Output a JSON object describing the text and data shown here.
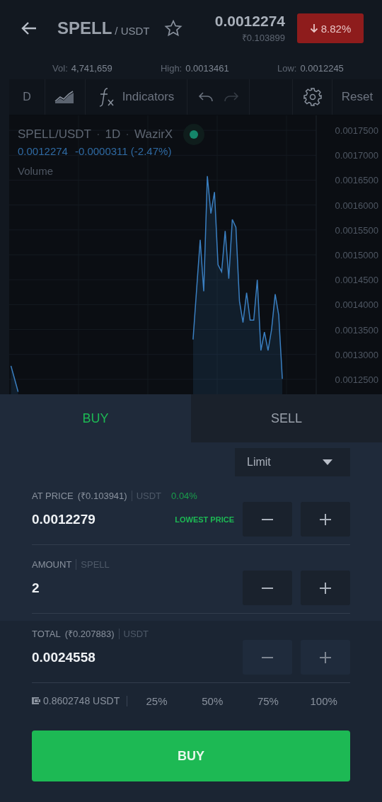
{
  "header": {
    "base": "SPELL",
    "quote": "/ USDT",
    "favorite": false,
    "price": "0.0012274",
    "price_inr": "₹0.103899",
    "change": "8.82%",
    "negative": true
  },
  "stats": [
    {
      "label": "Vol:",
      "value": "4,741,659"
    },
    {
      "label": "High:",
      "value": "0.0013461"
    },
    {
      "label": "Low:",
      "value": "0.0012245"
    }
  ],
  "toolbar": {
    "interval": "D",
    "indicators": "Indicators",
    "reset": "Reset"
  },
  "chart": {
    "separator": "·",
    "interval": "1D",
    "exchange": "WazirX",
    "last": "0.0012274",
    "change": "-0.0000311 (-2.47%)",
    "study": "Volume",
    "chart_data": {
      "type": "area",
      "categories": [
        null,
        null,
        null,
        null,
        null,
        null,
        null,
        null,
        null,
        null,
        null,
        null,
        null,
        null,
        null,
        null,
        null,
        null,
        null,
        null,
        null,
        null,
        null,
        null,
        null,
        null,
        null,
        null,
        null,
        null,
        null,
        null,
        null,
        null,
        null,
        null,
        null,
        null,
        null,
        null,
        null,
        null,
        null,
        null,
        null,
        null,
        null,
        null,
        null,
        null,
        null,
        null,
        null,
        null,
        null,
        null,
        null,
        null,
        null,
        null,
        null,
        null,
        null,
        null,
        null,
        null,
        null,
        null,
        null,
        null,
        null,
        null,
        null,
        null,
        null,
        null,
        null,
        null,
        null,
        null,
        null,
        null,
        null,
        null,
        null,
        null
      ],
      "series": [
        {
          "name": "SPELL/USDT",
          "color": "#3a7fc1",
          "values": [
            0.001277,
            0.001251,
            0.001225,
            null,
            null,
            null,
            null,
            null,
            null,
            null,
            null,
            null,
            null,
            null,
            null,
            null,
            null,
            null,
            null,
            null,
            null,
            null,
            null,
            null,
            null,
            null,
            null,
            null,
            null,
            null,
            null,
            null,
            null,
            null,
            null,
            null,
            null,
            null,
            null,
            null,
            null,
            null,
            null,
            null,
            null,
            null,
            null,
            null,
            null,
            null,
            null,
            0.00133,
            0.00143,
            0.00153,
            0.001427,
            0.001658,
            0.001583,
            0.001626,
            0.00148,
            0.001466,
            0.001548,
            0.001452,
            0.001571,
            0.001555,
            0.001407,
            0.001364,
            0.001424,
            0.001369,
            0.001369,
            0.00145,
            0.001308,
            0.001345,
            0.001308,
            0.00135,
            0.001421,
            0.001379,
            0.001251,
            null,
            null,
            null,
            null,
            null,
            null,
            null,
            null,
            null
          ]
        }
      ],
      "ylim": [
        0.00122,
        0.00178
      ],
      "grid": true,
      "yticks": [
        {
          "value": 0.00175,
          "label": "0.0017500"
        },
        {
          "value": 0.0017,
          "label": "0.0017000"
        },
        {
          "value": 0.00165,
          "label": "0.0016500"
        },
        {
          "value": 0.0016,
          "label": "0.0016000"
        },
        {
          "value": 0.00155,
          "label": "0.0015500"
        },
        {
          "value": 0.0015,
          "label": "0.0015000"
        },
        {
          "value": 0.00145,
          "label": "0.0014500"
        },
        {
          "value": 0.0014,
          "label": "0.0014000"
        },
        {
          "value": 0.00135,
          "label": "0.0013500"
        },
        {
          "value": 0.0013,
          "label": "0.0013000"
        },
        {
          "value": 0.00125,
          "label": "0.0012500"
        }
      ]
    }
  },
  "order": {
    "tabs": [
      {
        "label": "BUY",
        "selected": true
      },
      {
        "label": "SELL",
        "selected": false
      }
    ],
    "order_type": "Limit",
    "fields": [
      {
        "label": "AT PRICE",
        "note": "(₹0.103941)",
        "unit": "USDT",
        "extra": "0.04%",
        "value": "0.0012279",
        "hint": "LOWEST PRICE"
      },
      {
        "label": "AMOUNT",
        "unit": "SPELL",
        "value": "2"
      }
    ],
    "total": {
      "label": "TOTAL",
      "note": "(₹0.207883)",
      "unit": "USDT",
      "value": "0.0024558"
    },
    "balance": "0.8602748 USDT",
    "percents": [
      "25%",
      "50%",
      "75%",
      "100%"
    ],
    "submit": "BUY"
  }
}
